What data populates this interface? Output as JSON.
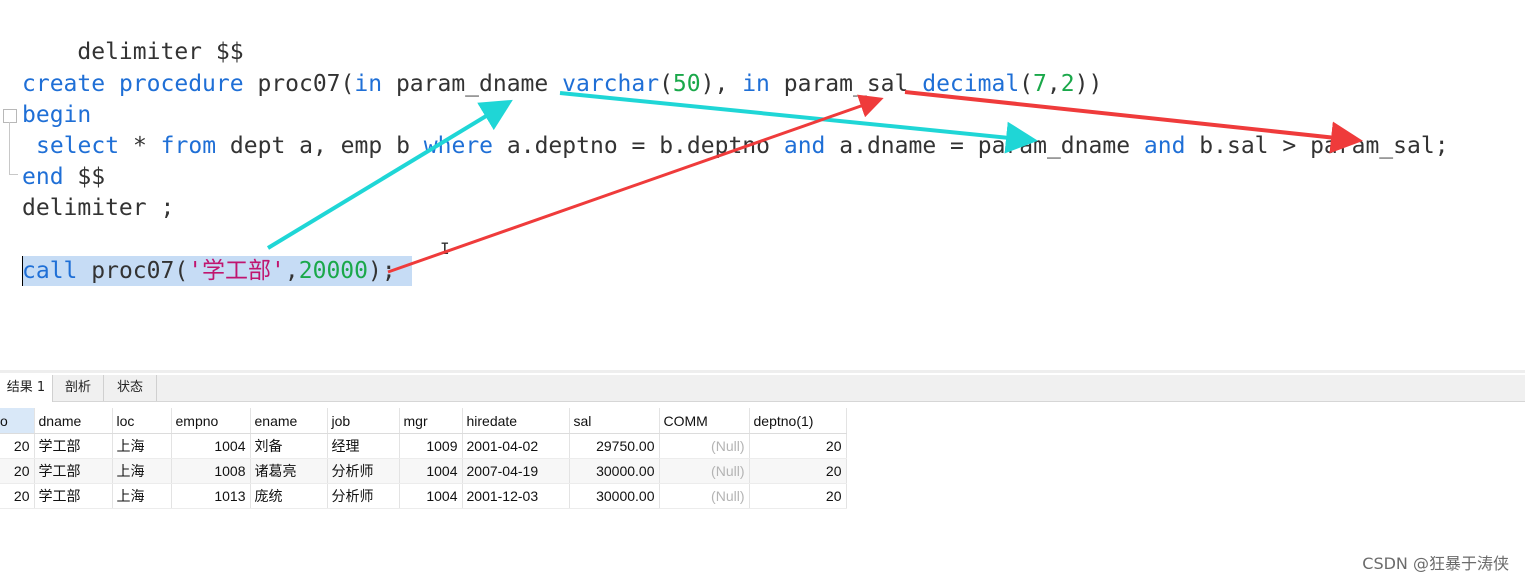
{
  "editor": {
    "line1": "delimiter $$",
    "create": {
      "kw_create": "create",
      "kw_procedure": "procedure",
      "name": "proc07(",
      "kw_in1": "in",
      "p1": "param_dname",
      "kw_varchar": "varchar",
      "open1": "(",
      "n50": "50",
      "close1": "),",
      "kw_in2": "in",
      "p2": "param_sal",
      "kw_decimal": "decimal",
      "open2": "(",
      "n7": "7",
      "comma": ",",
      "n2": "2",
      "close2": "))"
    },
    "begin": "begin",
    "select": {
      "kw_select": "select",
      "t1": "* ",
      "kw_from": "from",
      "t2": "dept a, emp b ",
      "kw_where": "where",
      "t3": "a.deptno = b.deptno ",
      "kw_and1": "and",
      "t4": "a.dname = param_dname ",
      "kw_and2": "and",
      "t5": "b.sal > param_sal;"
    },
    "end": {
      "kw_end": "end",
      "t": " $$"
    },
    "line_delim2": "delimiter ;",
    "call": {
      "kw_call": "call",
      "t1": "proc07(",
      "str": "'学工部'",
      "comma": ",",
      "num": "20000",
      "t2": ");"
    }
  },
  "annotations": {
    "arrow_param_dname_color": "#1fd6d6",
    "arrow_param_sal_color": "#ef3b3b"
  },
  "results": {
    "tabs": [
      "结果 1",
      "剖析",
      "状态"
    ],
    "columns": [
      "o",
      "dname",
      "loc",
      "empno",
      "ename",
      "job",
      "mgr",
      "hiredate",
      "sal",
      "COMM",
      "deptno(1)"
    ],
    "rows": [
      [
        "20",
        "学工部",
        "上海",
        "1004",
        "刘备",
        "经理",
        "1009",
        "2001-04-02",
        "29750.00",
        "(Null)",
        "20"
      ],
      [
        "20",
        "学工部",
        "上海",
        "1008",
        "诸葛亮",
        "分析师",
        "1004",
        "2007-04-19",
        "30000.00",
        "(Null)",
        "20"
      ],
      [
        "20",
        "学工部",
        "上海",
        "1013",
        "庞统",
        "分析师",
        "1004",
        "2001-12-03",
        "30000.00",
        "(Null)",
        "20"
      ]
    ]
  },
  "watermark": "CSDN @狂暴于涛侠"
}
